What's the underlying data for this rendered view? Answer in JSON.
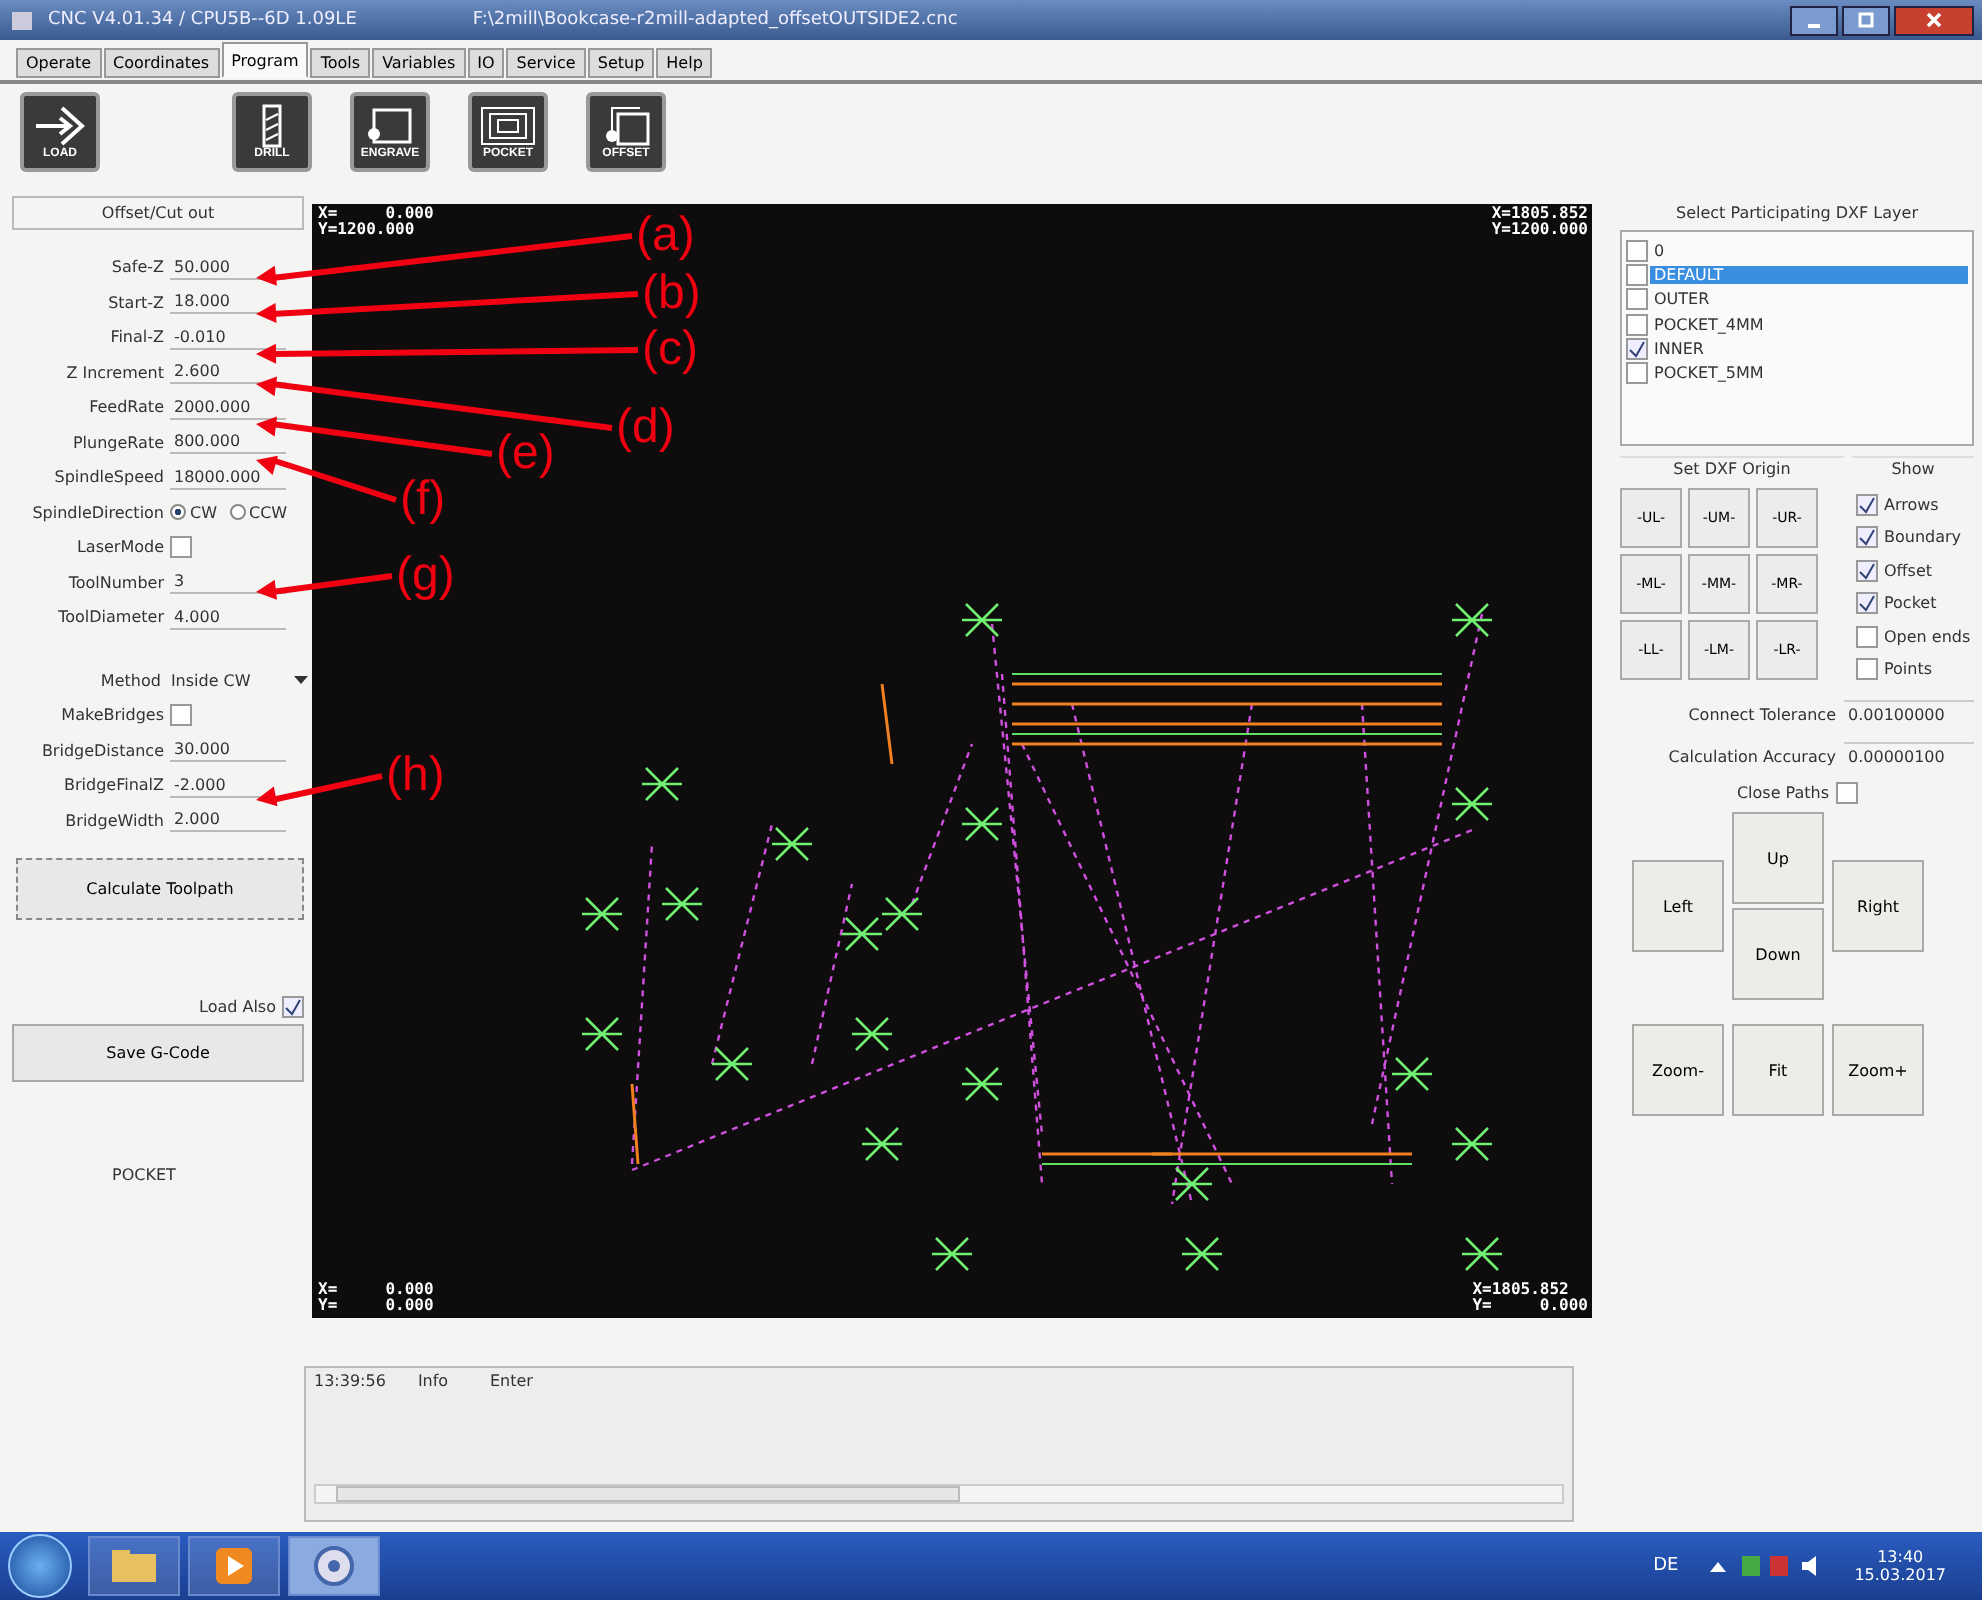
{
  "window": {
    "title": "CNC V4.01.34 / CPU5B--6D 1.09LE",
    "file": "F:\\2mill\\Bookcase-r2mill-adapted_offsetOUTSIDE2.cnc"
  },
  "tabs": [
    {
      "label": "Operate",
      "selected": false
    },
    {
      "label": "Coordinates",
      "selected": false
    },
    {
      "label": "Program",
      "selected": true
    },
    {
      "label": "Tools",
      "selected": false
    },
    {
      "label": "Variables",
      "selected": false
    },
    {
      "label": "IO",
      "selected": false
    },
    {
      "label": "Service",
      "selected": false
    },
    {
      "label": "Setup",
      "selected": false
    },
    {
      "label": "Help",
      "selected": false
    }
  ],
  "toolbar": [
    {
      "kind": "load",
      "label": "LOAD"
    },
    {
      "kind": "drill",
      "label": "DRILL"
    },
    {
      "kind": "engrave",
      "label": "ENGRAVE"
    },
    {
      "kind": "pocket",
      "label": "POCKET"
    },
    {
      "kind": "offset",
      "label": "OFFSET"
    }
  ],
  "left_panel": {
    "title": "Offset/Cut out",
    "params": [
      {
        "kind": "field",
        "label": "Safe-Z",
        "value": "50.000"
      },
      {
        "kind": "field",
        "label": "Start-Z",
        "value": "18.000"
      },
      {
        "kind": "field",
        "label": "Final-Z",
        "value": "-0.010"
      },
      {
        "kind": "field",
        "label": "Z Increment",
        "value": "2.600"
      },
      {
        "kind": "field",
        "label": "FeedRate",
        "value": "2000.000"
      },
      {
        "kind": "field",
        "label": "PlungeRate",
        "value": "800.000"
      },
      {
        "kind": "field",
        "label": "SpindleSpeed",
        "value": "18000.000"
      },
      {
        "kind": "radio",
        "label": "SpindleDirection",
        "options": [
          {
            "label": "CW",
            "selected": true
          },
          {
            "label": "CCW",
            "selected": false
          }
        ]
      },
      {
        "kind": "checkbox",
        "label": "LaserMode",
        "checked": false
      },
      {
        "kind": "field",
        "label": "ToolNumber",
        "value": "3"
      },
      {
        "kind": "field",
        "label": "ToolDiameter",
        "value": "4.000"
      },
      {
        "kind": "gap"
      },
      {
        "kind": "select",
        "label": "Method",
        "value": "Inside CW"
      },
      {
        "kind": "checkbox",
        "label": "MakeBridges",
        "checked": false
      },
      {
        "kind": "field",
        "label": "BridgeDistance",
        "value": "30.000"
      },
      {
        "kind": "field",
        "label": "BridgeFinalZ",
        "value": "-2.000"
      },
      {
        "kind": "field",
        "label": "BridgeWidth",
        "value": "2.000"
      }
    ],
    "calculate_button": "Calculate Toolpath",
    "load_also": {
      "label": "Load Also",
      "checked": true
    },
    "save_button": "Save G-Code",
    "mode": "POCKET"
  },
  "canvas": {
    "top_left": [
      "X=     0.000",
      "Y=1200.000"
    ],
    "top_right": [
      "X=1805.852",
      "Y=1200.000"
    ],
    "bottom_left": [
      "X=     0.000",
      "Y=     0.000"
    ],
    "bottom_right": [
      "X=1805.852",
      "Y=     0.000"
    ]
  },
  "annotations": [
    "(a)",
    "(b)",
    "(c)",
    "(d)",
    "(e)",
    "(f)",
    "(g)",
    "(h)"
  ],
  "right_panel": {
    "layer_title": "Select Participating DXF Layer",
    "layers": [
      {
        "label": "0",
        "checked": false,
        "selected": false
      },
      {
        "label": "DEFAULT",
        "checked": false,
        "selected": true
      },
      {
        "label": "OUTER",
        "checked": false,
        "selected": false
      },
      {
        "label": "POCKET_4MM",
        "checked": false,
        "selected": false
      },
      {
        "label": "INNER",
        "checked": true,
        "selected": false
      },
      {
        "label": "POCKET_5MM",
        "checked": false,
        "selected": false
      }
    ],
    "origin_title": "Set DXF Origin",
    "origin_buttons": [
      "-UL-",
      "-UM-",
      "-UR-",
      "-ML-",
      "-MM-",
      "-MR-",
      "-LL-",
      "-LM-",
      "-LR-"
    ],
    "show_title": "Show",
    "show": [
      {
        "label": "Arrows",
        "checked": true
      },
      {
        "label": "Boundary",
        "checked": true
      },
      {
        "label": "Offset",
        "checked": true
      },
      {
        "label": "Pocket",
        "checked": true
      },
      {
        "label": "Open ends",
        "checked": false
      },
      {
        "label": "Points",
        "checked": false
      }
    ],
    "settings": [
      {
        "label": "Connect Tolerance",
        "value": "0.00100000"
      },
      {
        "label": "Calculation Accuracy",
        "value": "0.00000100"
      }
    ],
    "close_paths": {
      "label": "Close Paths",
      "checked": false
    },
    "nav": {
      "up": "Up",
      "left": "Left",
      "right": "Right",
      "down": "Down",
      "zoom_out": "Zoom-",
      "fit": "Fit",
      "zoom_in": "Zoom+"
    }
  },
  "log": [
    {
      "time": "13:39:56",
      "level": "Info",
      "message": "Enter"
    }
  ],
  "taskbar": {
    "language": "DE",
    "time": "13:40",
    "date": "15.03.2017"
  }
}
